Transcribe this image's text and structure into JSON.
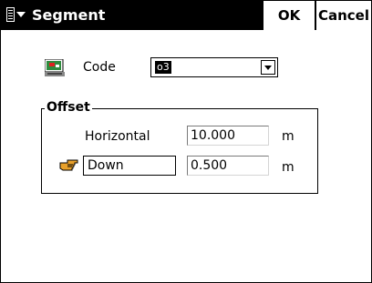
{
  "title": "Segment",
  "buttons": {
    "ok": "OK",
    "cancel": "Cancel"
  },
  "code": {
    "label": "Code",
    "value": "o3"
  },
  "offset": {
    "group_title": "Offset",
    "horizontal_label": "Horizontal",
    "horizontal_value": "10.000",
    "horizontal_unit": "m",
    "vertical_mode": "Down",
    "vertical_value": "0.500",
    "vertical_unit": "m"
  }
}
